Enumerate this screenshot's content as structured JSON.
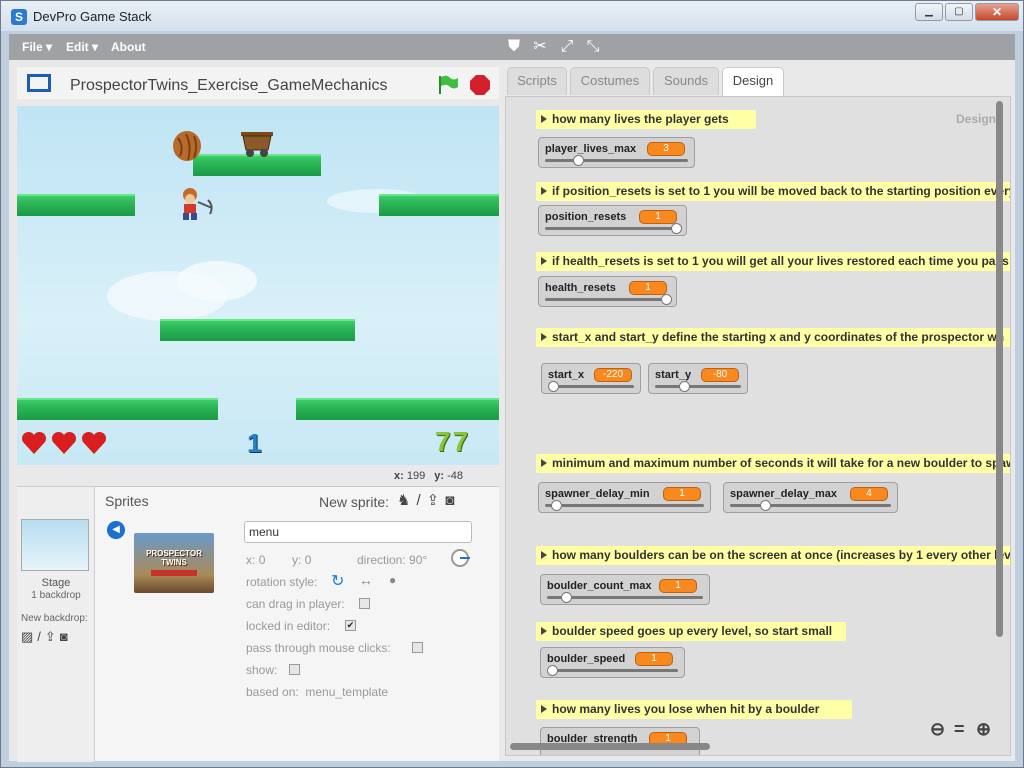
{
  "window": {
    "title": "DevPro Game Stack",
    "icon_letter": "S"
  },
  "menubar": {
    "file": "File ▾",
    "edit": "Edit ▾",
    "about": "About"
  },
  "toolbar": {
    "icons": [
      "duplicate-stamp-icon",
      "cut-icon",
      "grow-icon",
      "shrink-icon"
    ]
  },
  "stage": {
    "title": "ProspectorTwins_Exercise_GameMechanics",
    "lives_icons": [
      "heart",
      "heart",
      "heart"
    ],
    "level": "1",
    "score": "77",
    "coords": {
      "x_label": "x:",
      "x": "199",
      "y_label": "y:",
      "y": "-48"
    }
  },
  "sprites": {
    "header": "Sprites",
    "new_sprite": "New sprite:",
    "stage_label": "Stage",
    "backdrop_count": "1 backdrop",
    "new_backdrop": "New backdrop:",
    "sprite_name": "menu",
    "thumb_title": "PROSPECTOR TWINS",
    "x_label": "x:",
    "x": "0",
    "y_label": "y:",
    "y": "0",
    "direction_label": "direction:",
    "direction": "90°",
    "rotation_style": "rotation style:",
    "can_drag": "can drag in player:",
    "locked": "locked in editor:",
    "pass_through": "pass through mouse clicks:",
    "show": "show:",
    "based_on_label": "based on:",
    "based_on": "menu_template"
  },
  "tabs": [
    "Scripts",
    "Costumes",
    "Sounds",
    "Design"
  ],
  "design": {
    "label": "Design",
    "comments": [
      "how many lives the player gets",
      "if position_resets is set to 1 you will be moved back to the starting position every",
      "if health_resets is set to 1 you will get all your lives restored each time you pass",
      "start_x and start_y define the starting x and y coordinates of the prospector wh",
      "minimum and maximum number of seconds it will take for a new boulder to spaw",
      "how many boulders can be on the screen at once (increases by 1 every other lev",
      "boulder speed goes up every level, so start small",
      "how many lives you lose when hit by a boulder"
    ],
    "vars": [
      {
        "name": "player_lives_max",
        "value": "3"
      },
      {
        "name": "position_resets",
        "value": "1"
      },
      {
        "name": "health_resets",
        "value": "1"
      },
      {
        "name": "start_x",
        "value": "-220"
      },
      {
        "name": "start_y",
        "value": "-80"
      },
      {
        "name": "spawner_delay_min",
        "value": "1"
      },
      {
        "name": "spawner_delay_max",
        "value": "4"
      },
      {
        "name": "boulder_count_max",
        "value": "1"
      },
      {
        "name": "boulder_speed",
        "value": "1"
      },
      {
        "name": "boulder_strength",
        "value": "1"
      }
    ]
  }
}
